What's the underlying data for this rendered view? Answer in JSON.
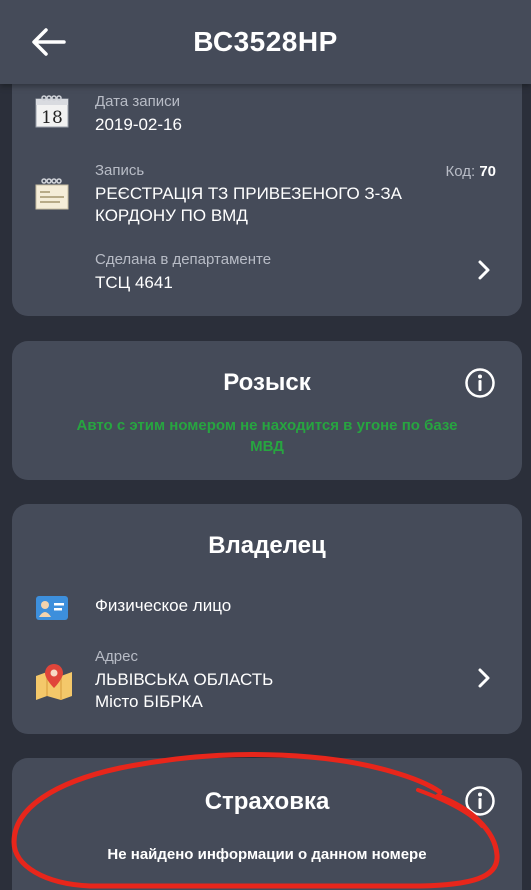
{
  "header": {
    "title": "ВС3528НР"
  },
  "record": {
    "date_label": "Дата записи",
    "date_value": "2019-02-16",
    "calendar_day": "18",
    "entry_label": "Запись",
    "code_label": "Код:",
    "code_value": "70",
    "entry_line1": "РЕЄСТРАЦІЯ ТЗ ПРИВЕЗЕНОГО З-ЗА",
    "entry_line2": "КОРДОНУ ПО ВМД",
    "dept_label": "Сделана в департаменте",
    "dept_value": "ТСЦ 4641"
  },
  "search": {
    "title": "Розыск",
    "message_line1": "Авто с этим номером не находится в угоне по базе",
    "message_line2": "МВД"
  },
  "owner": {
    "title": "Владелец",
    "type": "Физическое лицо",
    "address_label": "Адрес",
    "address_line1": "ЛЬВІВСЬКА ОБЛАСТЬ",
    "address_line2": "Місто БІБРКА"
  },
  "insurance": {
    "title": "Страховка",
    "message": "Не найдено информации о данном номере"
  },
  "colors": {
    "background": "#2b2f3a",
    "card": "#454b59",
    "success_text": "#27a540",
    "annotation": "#e8261b"
  },
  "icons": [
    "back-arrow-icon",
    "calendar-icon",
    "document-icon",
    "chevron-right-icon",
    "info-icon",
    "id-card-icon",
    "map-pin-icon"
  ]
}
